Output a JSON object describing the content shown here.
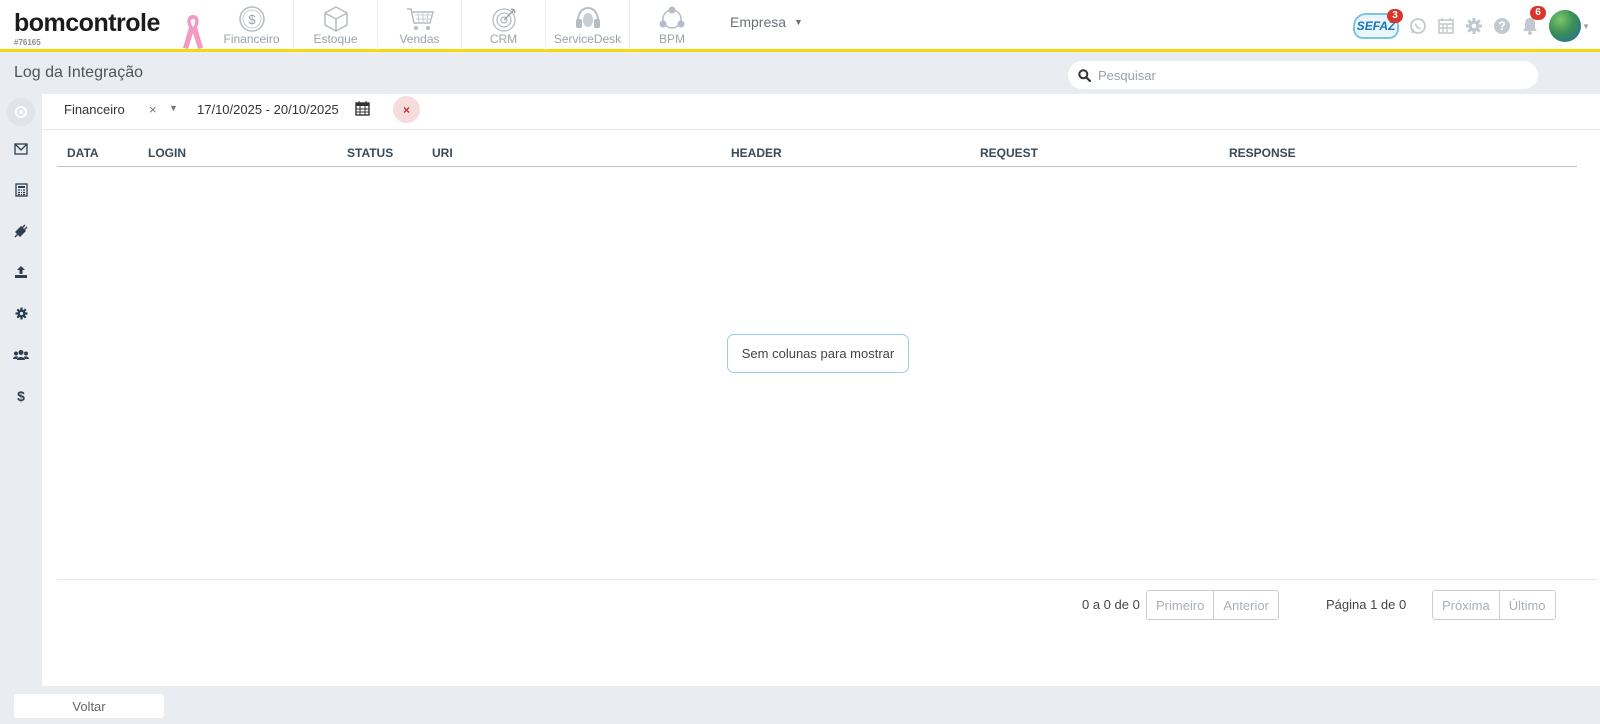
{
  "brand": {
    "name": "bomcontrole",
    "account_id": "#76165"
  },
  "modules": [
    {
      "label": "Financeiro",
      "icon": "dollar-coin-icon"
    },
    {
      "label": "Estoque",
      "icon": "box-icon"
    },
    {
      "label": "Vendas",
      "icon": "cart-icon"
    },
    {
      "label": "CRM",
      "icon": "target-icon"
    },
    {
      "label": "ServiceDesk",
      "icon": "headset-icon"
    },
    {
      "label": "BPM",
      "icon": "process-icon"
    }
  ],
  "empresa": {
    "label": "Empresa"
  },
  "header_icons": {
    "sefaz": {
      "label": "SEFAZ",
      "badge": "3"
    },
    "notifications_badge": "6"
  },
  "page": {
    "title": "Log da Integração"
  },
  "search": {
    "placeholder": "Pesquisar",
    "value": ""
  },
  "sidenav": [
    {
      "name": "envelope-icon"
    },
    {
      "name": "calculator-icon"
    },
    {
      "name": "plug-icon"
    },
    {
      "name": "upload-icon"
    },
    {
      "name": "gear-icon"
    },
    {
      "name": "users-icon"
    },
    {
      "name": "dollar-icon"
    }
  ],
  "filters": {
    "module_value": "Financeiro",
    "clear_symbol": "×",
    "date_range": "17/10/2025 - 20/10/2025",
    "remove_symbol": "×"
  },
  "table": {
    "columns": [
      "DATA",
      "LOGIN",
      "STATUS",
      "URI",
      "HEADER",
      "REQUEST",
      "RESPONSE"
    ],
    "rows": [],
    "empty_message": "Sem colunas para mostrar"
  },
  "pagination": {
    "range_text": "0 a 0 de 0",
    "first": "Primeiro",
    "previous": "Anterior",
    "page_text": "Página 1 de 0",
    "next": "Próxima",
    "last": "Último"
  },
  "footer": {
    "back_label": "Voltar"
  },
  "colors": {
    "accent_yellow": "#f5d90a",
    "badge_red": "#d9352c",
    "header_text": "#3a4a58",
    "background": "#e9edf1"
  }
}
